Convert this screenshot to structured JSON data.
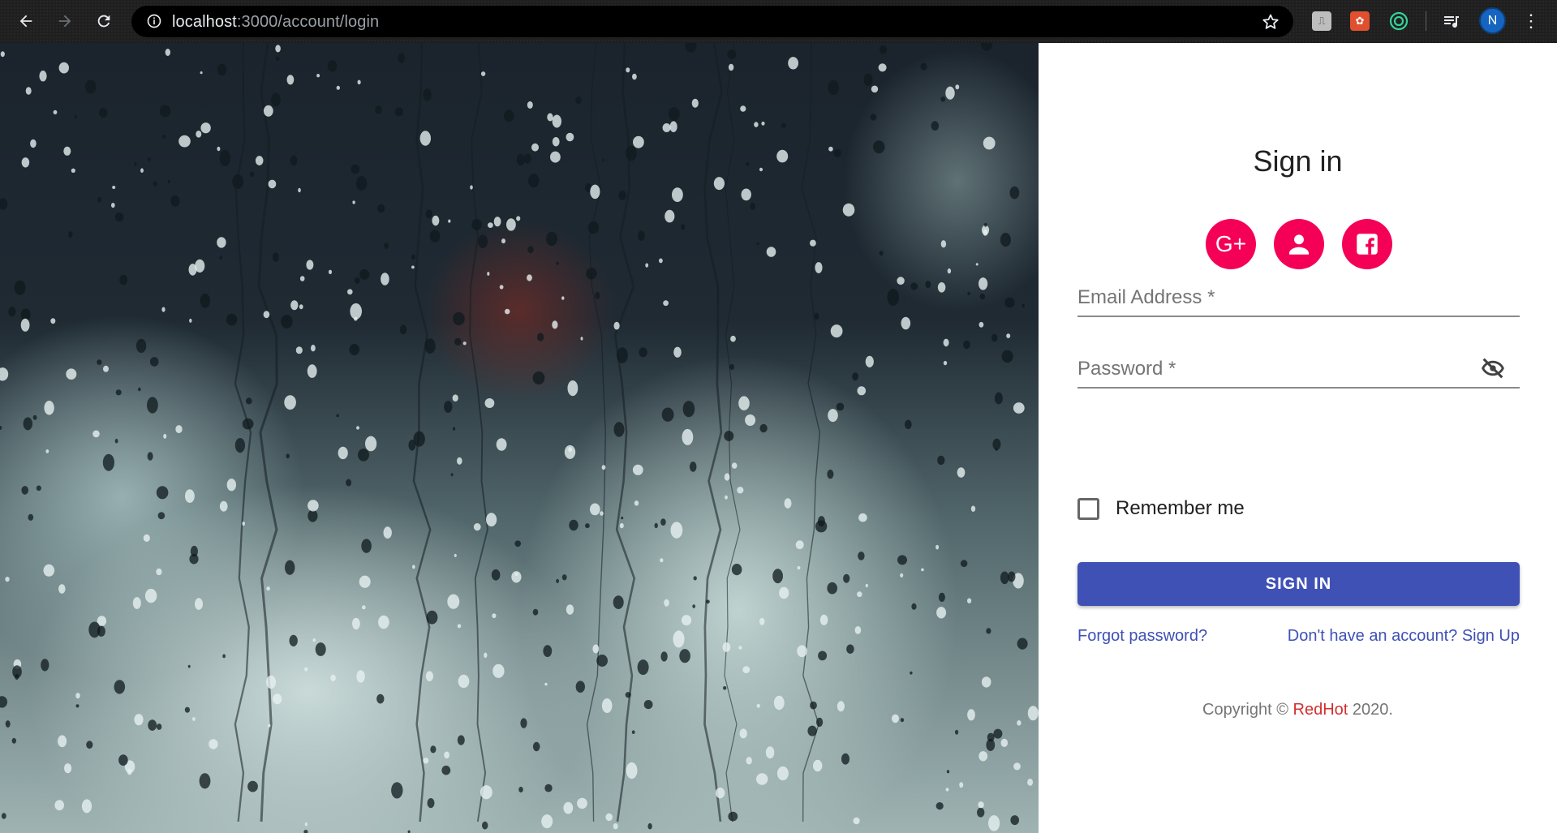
{
  "browser": {
    "url_host": "localhost",
    "url_path": ":3000/account/login",
    "profile_initial": "N"
  },
  "colors": {
    "accent_pink": "#f50057",
    "primary_indigo": "#3f51b5",
    "brand_red": "#d32f2f"
  },
  "login": {
    "title": "Sign in",
    "social_buttons": [
      {
        "icon": "google-plus-icon",
        "label": "G+"
      },
      {
        "icon": "person-icon"
      },
      {
        "icon": "facebook-icon"
      }
    ],
    "email_label": "Email Address *",
    "password_label": "Password *",
    "remember_label": "Remember me",
    "submit_label": "SIGN IN",
    "forgot_link": "Forgot password?",
    "signup_link": "Don't have an account? Sign Up",
    "copyright_prefix": "Copyright ©",
    "copyright_brand": "RedHot",
    "copyright_suffix": "2020."
  }
}
